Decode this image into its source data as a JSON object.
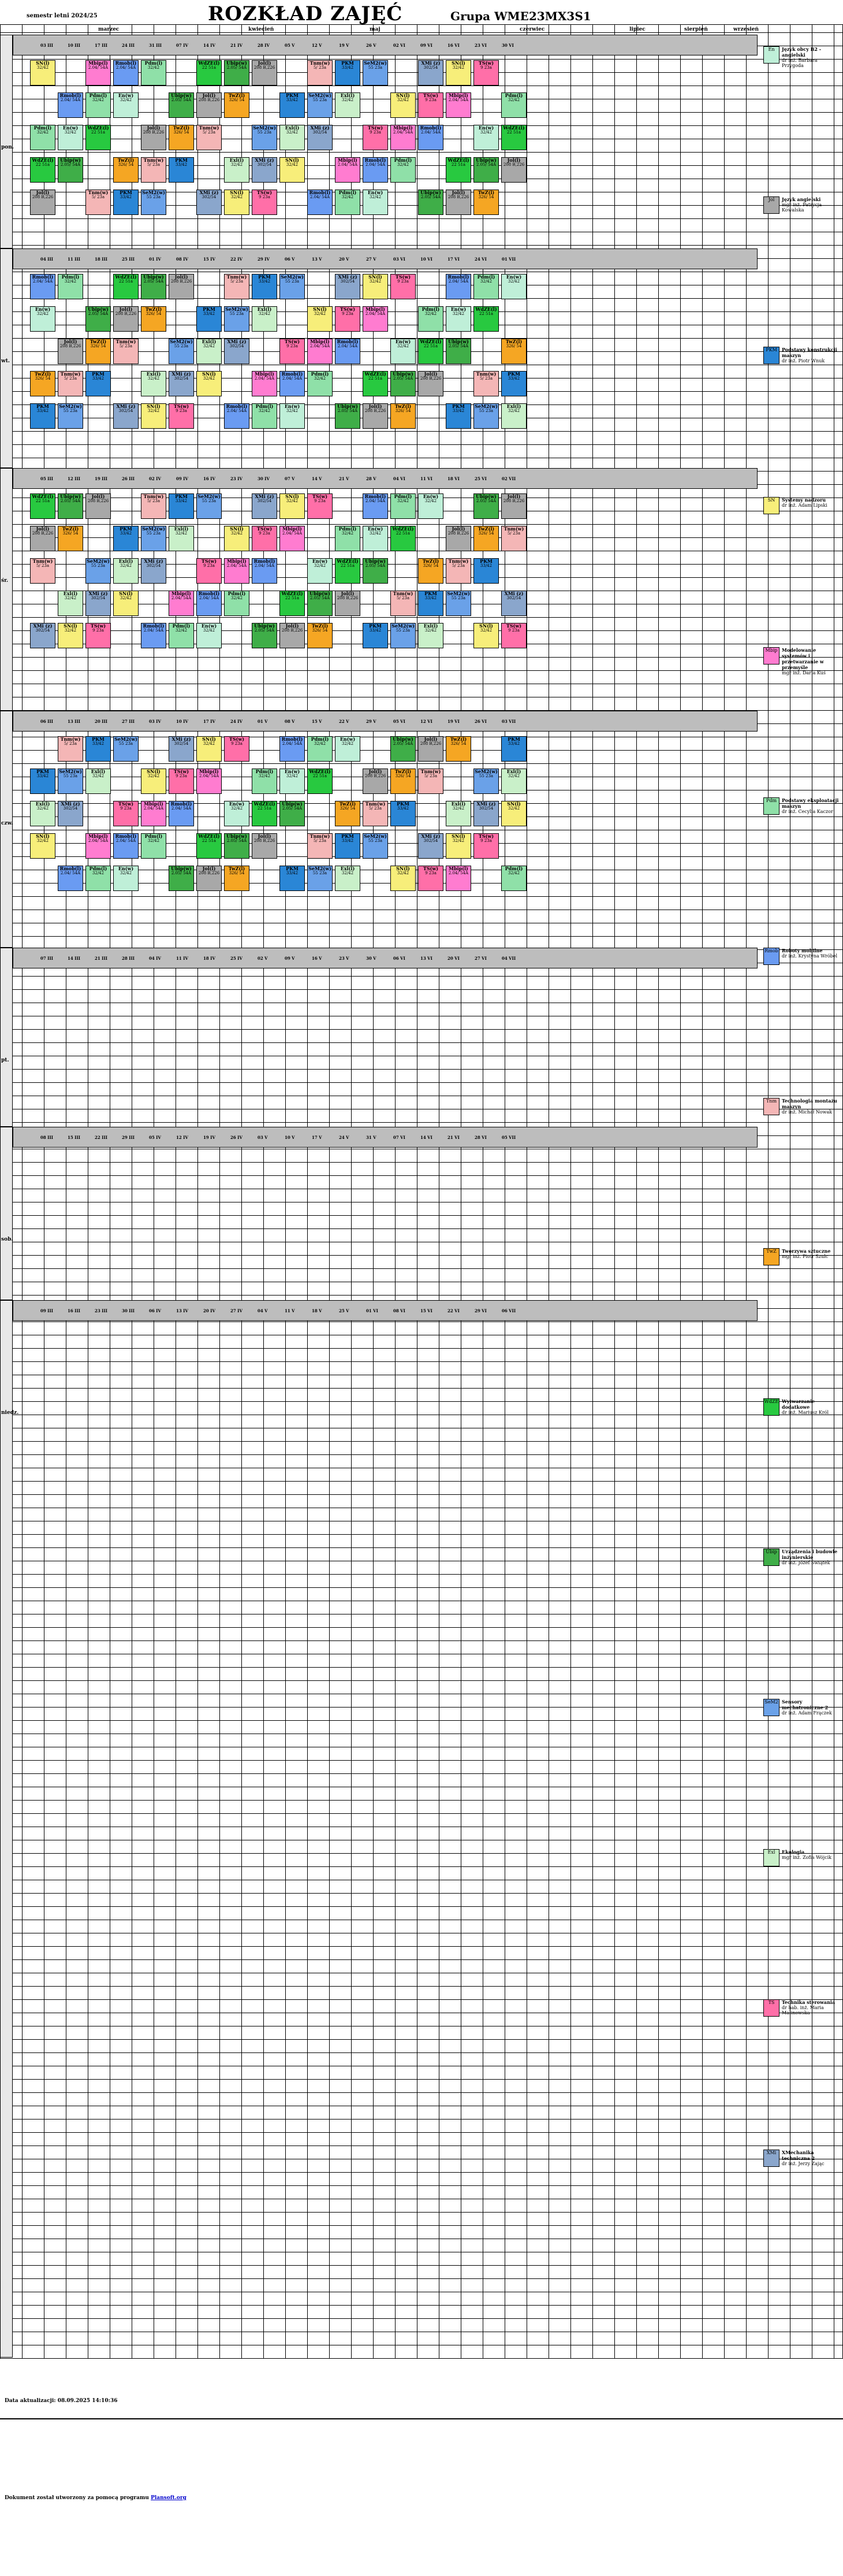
{
  "header": {
    "semester": "semestr letni 2024/25",
    "title": "ROZKŁAD ZAJĘĆ",
    "group": "Grupa WME23MX3S1"
  },
  "months": [
    "marzec",
    "kwiecień",
    "maj",
    "czerwiec",
    "lipiec",
    "sierpień",
    "wrzesień"
  ],
  "days": [
    "pon.",
    "wt.",
    "śr.",
    "czw.",
    "pt.",
    "sob.",
    "niedz."
  ],
  "date_headers": [
    [
      "03 III",
      "10 III",
      "17 III",
      "24 III",
      "31 III",
      "07 IV",
      "14 IV",
      "21 IV",
      "28 IV",
      "05 V",
      "12 V",
      "19 V",
      "26 V",
      "02 VI",
      "09 VI",
      "16 VI",
      "23 VI",
      "30 VI"
    ],
    [
      "04 III",
      "11 III",
      "18 III",
      "25 III",
      "01 IV",
      "08 IV",
      "15 IV",
      "22 IV",
      "29 IV",
      "06 V",
      "13 V",
      "20 V",
      "27 V",
      "03 VI",
      "10 VI",
      "17 VI",
      "24 VI",
      "01 VII"
    ],
    [
      "05 III",
      "12 III",
      "19 III",
      "26 III",
      "02 IV",
      "09 IV",
      "16 IV",
      "23 IV",
      "30 IV",
      "07 V",
      "14 V",
      "21 V",
      "28 V",
      "04 VI",
      "11 VI",
      "18 VI",
      "25 VI",
      "02 VII"
    ],
    [
      "06 III",
      "13 III",
      "20 III",
      "27 III",
      "03 IV",
      "10 IV",
      "17 IV",
      "24 IV",
      "01 V",
      "08 V",
      "15 V",
      "22 V",
      "29 V",
      "05 VI",
      "12 VI",
      "19 VI",
      "26 VI",
      "03 VII"
    ],
    [
      "07 III",
      "14 III",
      "21 III",
      "28 III",
      "04 IV",
      "11 IV",
      "18 IV",
      "25 IV",
      "02 V",
      "09 V",
      "16 V",
      "23 V",
      "30 V",
      "06 VI",
      "13 VI",
      "20 VI",
      "27 VI",
      "04 VII"
    ],
    [
      "08 III",
      "15 III",
      "22 III",
      "29 III",
      "05 IV",
      "12 IV",
      "19 IV",
      "26 IV",
      "03 V",
      "10 V",
      "17 V",
      "24 V",
      "31 V",
      "07 VI",
      "14 VI",
      "21 VI",
      "28 VI",
      "05 VII"
    ],
    [
      "09 III",
      "16 III",
      "23 III",
      "30 III",
      "06 IV",
      "13 IV",
      "20 IV",
      "27 IV",
      "04 V",
      "11 V",
      "18 V",
      "25 V",
      "01 VI",
      "08 VI",
      "15 VI",
      "22 VI",
      "29 VI",
      "06 VII"
    ]
  ],
  "classes": [
    {
      "code": "SN(l)",
      "room": "32/42",
      "color": "#f7ee7a"
    },
    {
      "code": "TS(w)",
      "room": "9 23a",
      "color": "#ff6fa8"
    },
    {
      "code": "Mbip(l)",
      "room": "2.04/ 54A",
      "color": "#ff7cd0"
    },
    {
      "code": "Rmob(l)",
      "room": "2.04/ 54A",
      "color": "#6a9bf2"
    },
    {
      "code": "Pdm(l)",
      "room": "32/42",
      "color": "#8fe0a8"
    },
    {
      "code": "En(w)",
      "room": "32/42",
      "color": "#bfefd8"
    },
    {
      "code": "WdZE(l)",
      "room": "22 51a",
      "color": "#28c940"
    },
    {
      "code": "Ubip(w)",
      "room": "2.05/ 54A",
      "color": "#3fae48"
    },
    {
      "code": "Jol(l)",
      "room": "208 B,226",
      "color": "#a8a8a8"
    },
    {
      "code": "TwZ(l)",
      "room": "326/ 54",
      "color": "#f5a623"
    },
    {
      "code": "Tnm(w)",
      "room": "5/ 23a",
      "color": "#f4b6b6"
    },
    {
      "code": "PKM",
      "room": "33/42",
      "color": "#2a86d6"
    },
    {
      "code": "SeM2(w)",
      "room": "55 23a",
      "color": "#6aa1e8"
    },
    {
      "code": "Exl(l)",
      "room": "32/42",
      "color": "#c9f0c9"
    },
    {
      "code": "XMi (z)",
      "room": "302/54",
      "color": "#8aa6cc"
    }
  ],
  "legend": [
    {
      "abbr": "En",
      "name": "Język obcy B2 - angielski",
      "teacher": "dr inż. Barbara Przygoda"
    },
    {
      "abbr": "Jol",
      "name": "Język angielski",
      "teacher": "mgr inż. Patrycja Kowalska"
    },
    {
      "abbr": "PKM",
      "name": "Podstawy konstrukcji maszyn",
      "teacher": "dr inż. Piotr Wnuk"
    },
    {
      "abbr": "SN",
      "name": "Systemy nadzoru",
      "teacher": "dr inż. Adam Lipski"
    },
    {
      "abbr": "Mbip",
      "name": "Modelowanie systemów i przetwarzanie w przemyśle",
      "teacher": "mgr inż. Daria Kuś"
    },
    {
      "abbr": "Pdm",
      "name": "Podstawy eksploatacji maszyn",
      "teacher": "dr inż. Cecylia Kaczor"
    },
    {
      "abbr": "Rmob",
      "name": "Roboty mobilne",
      "teacher": "dr inż. Krystyna Wróbel"
    },
    {
      "abbr": "Tnm",
      "name": "Technologia montażu maszyn",
      "teacher": "dr inż. Michał Nowak"
    },
    {
      "abbr": "TwZ",
      "name": "Tworzywa sztuczne",
      "teacher": "mgr inż. Piotr Szulc"
    },
    {
      "abbr": "WdZE",
      "name": "Wytwarzanie dodatkowe",
      "teacher": "dr inż. Mariusz Król"
    },
    {
      "abbr": "Ubip",
      "name": "Urządzenia i budowle inżynierskie",
      "teacher": "dr inż. Józef Świątek"
    },
    {
      "abbr": "SeM2",
      "name": "Sensory mechatroniczne 2",
      "teacher": "dr inż. Adam Frączek"
    },
    {
      "abbr": "Exl",
      "name": "Ekologia",
      "teacher": "mgr inż. Zofia Wójcik"
    },
    {
      "abbr": "TS",
      "name": "Technika sterowania",
      "teacher": "dr hab. inż. Maria Malinowska"
    },
    {
      "abbr": "XMi",
      "name": "XMechanika techniczna 2",
      "teacher": "dr inż. Jerzy Zając"
    }
  ],
  "footer": {
    "update": "Data aktualizacji: 08.09.2025 14:10:36",
    "generated_prefix": "Dokument został utworzony za pomocą programu",
    "program": "Plansoft.org"
  }
}
